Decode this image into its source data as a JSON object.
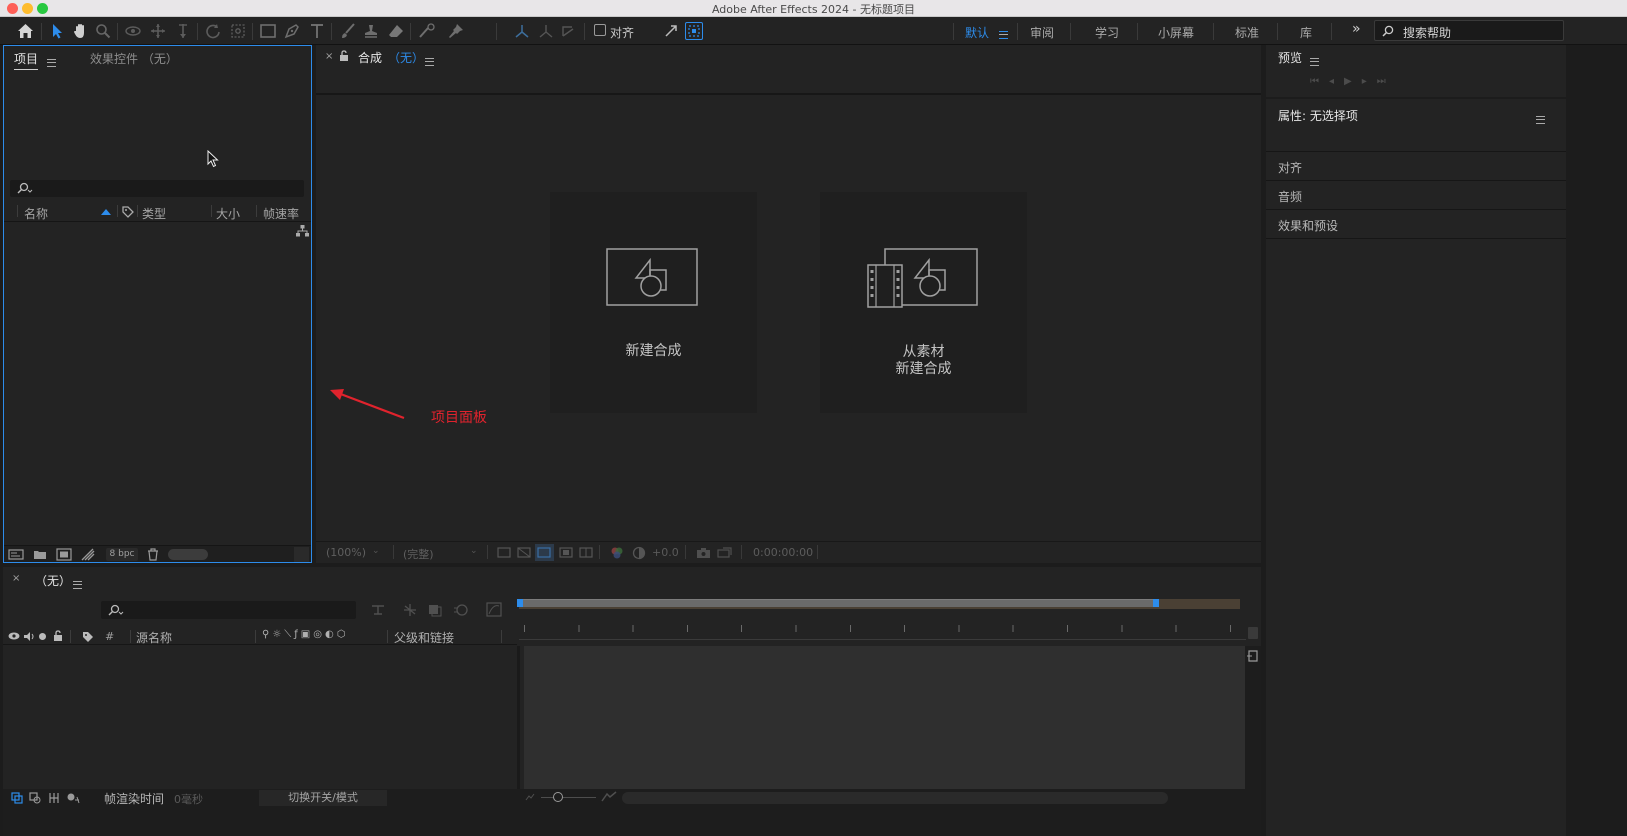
{
  "window": {
    "title": "Adobe After Effects 2024 - 无标题项目"
  },
  "toolbar": {
    "snap_label": "对齐",
    "workspaces": [
      "默认",
      "审阅",
      "学习",
      "小屏幕",
      "标准",
      "库"
    ],
    "active_workspace": "默认",
    "search_placeholder": "搜索帮助"
  },
  "project_panel": {
    "tab_project": "项目",
    "tab_effects": "效果控件 （无）",
    "columns": {
      "name": "名称",
      "type": "类型",
      "size": "大小",
      "fps": "帧速率"
    },
    "bpc": "8 bpc"
  },
  "composition_panel": {
    "tab_label": "合成",
    "tab_value": "（无）",
    "new_comp_label": "新建合成",
    "from_footage_line1": "从素材",
    "from_footage_line2": "新建合成",
    "zoom": "(100%)",
    "resolution": "(完整)",
    "exposure": "+0.0",
    "timecode": "0:00:00:00"
  },
  "annotation": {
    "label": "项目面板",
    "color": "#e0232d"
  },
  "right_panels": {
    "preview_title": "预览",
    "properties_title": "属性: 无选择项",
    "sections": [
      "对齐",
      "音频",
      "效果和预设"
    ]
  },
  "timeline": {
    "tab_label": "（无）",
    "col_source": "源名称",
    "col_parent": "父级和链接",
    "col_hash": "#",
    "render_time_label": "帧渲染时间",
    "render_time_value": "0毫秒",
    "toggle_label": "切换开关/模式"
  },
  "colors": {
    "accent": "#2d8ceb",
    "panel": "#232323",
    "background": "#1c1c1c"
  }
}
